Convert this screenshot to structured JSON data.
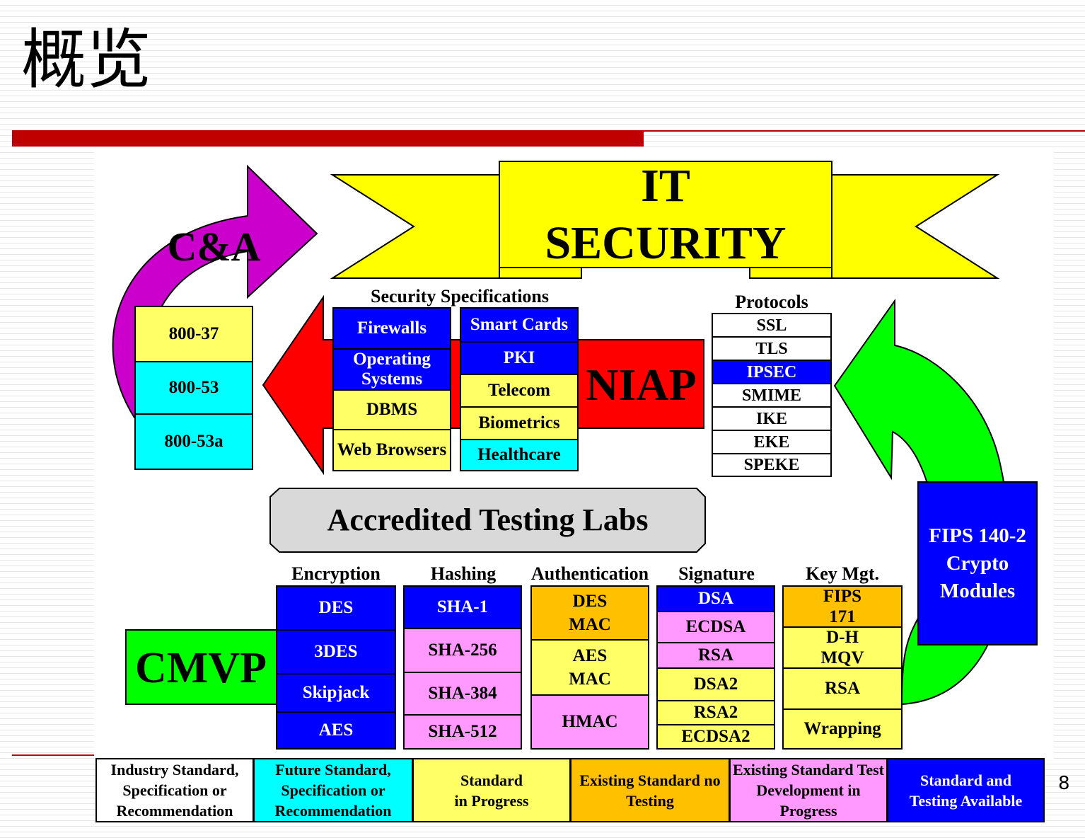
{
  "slide": {
    "title": "概览",
    "page_number": "8"
  },
  "banner": {
    "line1": "IT",
    "line2": "SECURITY"
  },
  "cna": {
    "label": "C&A",
    "items": [
      "800-37",
      "800-53",
      "800-53a"
    ]
  },
  "security_specs": {
    "header": "Security Specifications",
    "left": [
      {
        "label": "Firewalls",
        "status": "blue"
      },
      {
        "label": "Operating Systems",
        "status": "blue"
      },
      {
        "label": "DBMS",
        "status": "yellow"
      },
      {
        "label": "Web Browsers",
        "status": "yellow"
      }
    ],
    "right": [
      {
        "label": "Smart Cards",
        "status": "blue"
      },
      {
        "label": "PKI",
        "status": "blue"
      },
      {
        "label": "Telecom",
        "status": "yellow"
      },
      {
        "label": "Biometrics",
        "status": "yellow"
      },
      {
        "label": "Healthcare",
        "status": "cyan"
      }
    ]
  },
  "niap": {
    "label": "NIAP"
  },
  "protocols": {
    "header": "Protocols",
    "items": [
      "SSL",
      "TLS",
      "IPSEC",
      "SMIME",
      "IKE",
      "EKE",
      "SPEKE"
    ]
  },
  "labs": {
    "label": "Accredited Testing Labs"
  },
  "fips": {
    "label": "FIPS 140-2 Crypto Modules"
  },
  "cmvp": {
    "label": "CMVP",
    "encryption": {
      "header": "Encryption",
      "items": [
        "DES",
        "3DES",
        "Skipjack",
        "AES"
      ]
    },
    "hashing": {
      "header": "Hashing",
      "items": [
        "SHA-1",
        "SHA-256",
        "SHA-384",
        "SHA-512"
      ]
    },
    "authentication": {
      "header": "Authentication",
      "items": [
        "DES MAC",
        "AES MAC",
        "HMAC"
      ]
    },
    "signature": {
      "header": "Signature",
      "items": [
        "DSA",
        "ECDSA",
        "RSA",
        "DSA2",
        "RSA2",
        "ECDSA2"
      ]
    },
    "keymgt": {
      "header": "Key Mgt.",
      "items": [
        "FIPS 171",
        "D-H MQV",
        "RSA",
        "Wrapping"
      ]
    }
  },
  "legend": [
    {
      "label": "Industry Standard, Specification or Recommendation",
      "color": "#ffffff"
    },
    {
      "label": "Future Standard, Specification or Recommendation",
      "color": "#00ffff"
    },
    {
      "label": "Standard in Progress",
      "color": "#ffff66"
    },
    {
      "label": "Existing Standard no Testing",
      "color": "#ffc000"
    },
    {
      "label": "Existing Standard Test Development in Progress",
      "color": "#ff99ff"
    },
    {
      "label": "Standard and Testing Available",
      "color": "#0000ff"
    }
  ]
}
